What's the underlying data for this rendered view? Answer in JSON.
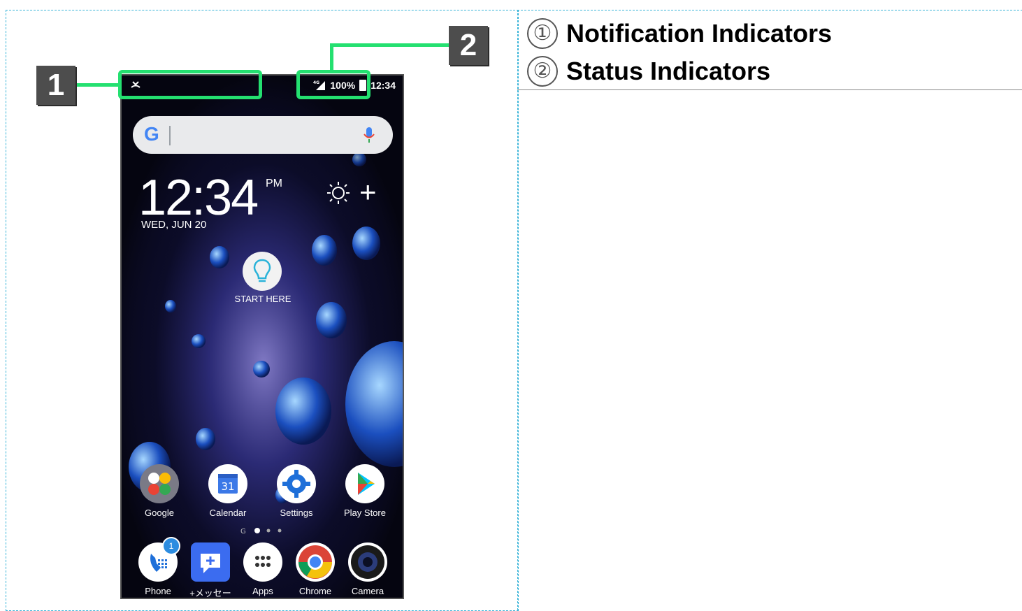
{
  "statusbar": {
    "battery_text": "100%",
    "time": "12:34",
    "network": "4G"
  },
  "home": {
    "clock": "12:34",
    "ampm": "PM",
    "date": "WED, JUN 20",
    "start_label": "START HERE"
  },
  "apps_row1": [
    {
      "label": "Google",
      "icon": "google-folder-icon",
      "color": "#7a7a86"
    },
    {
      "label": "Calendar",
      "icon": "calendar-icon",
      "color": "#ffffff"
    },
    {
      "label": "Settings",
      "icon": "settings-gear-icon",
      "color": "#ffffff"
    },
    {
      "label": "Play Store",
      "icon": "play-store-icon",
      "color": "#ffffff"
    }
  ],
  "apps_row2": [
    {
      "label": "Phone",
      "icon": "phone-icon",
      "color": "#ffffff",
      "badge": "1"
    },
    {
      "label": "+メッセー",
      "icon": "message-plus-icon",
      "color": "#3b6cf0"
    },
    {
      "label": "Apps",
      "icon": "apps-grid-icon",
      "color": "#ffffff"
    },
    {
      "label": "Chrome",
      "icon": "chrome-icon",
      "color": "#ffffff"
    },
    {
      "label": "Camera",
      "icon": "camera-icon",
      "color": "#1a1a1a"
    }
  ],
  "calendar_day": "31",
  "callouts": [
    {
      "number": "1"
    },
    {
      "number": "2"
    }
  ],
  "legend": [
    {
      "num": "①",
      "text": "Notification Indicators"
    },
    {
      "num": "②",
      "text": "Status Indicators"
    }
  ],
  "colors": {
    "callout": "#24e070",
    "border": "#39b4d8"
  }
}
